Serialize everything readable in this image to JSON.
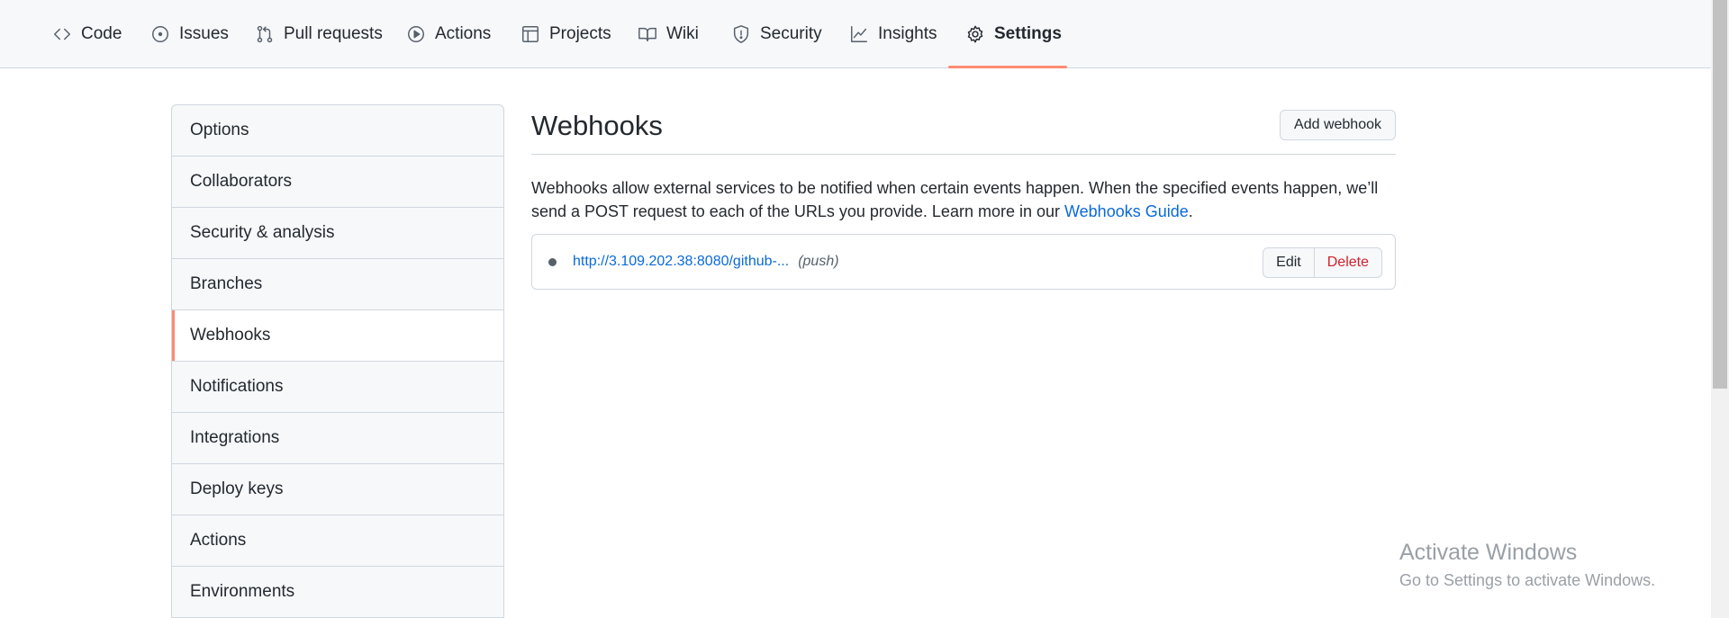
{
  "nav": {
    "tabs": [
      {
        "label": "Code",
        "icon": "code-icon"
      },
      {
        "label": "Issues",
        "icon": "issue-icon"
      },
      {
        "label": "Pull requests",
        "icon": "pull-request-icon"
      },
      {
        "label": "Actions",
        "icon": "play-icon"
      },
      {
        "label": "Projects",
        "icon": "table-icon"
      },
      {
        "label": "Wiki",
        "icon": "book-icon"
      },
      {
        "label": "Security",
        "icon": "shield-icon"
      },
      {
        "label": "Insights",
        "icon": "graph-icon"
      },
      {
        "label": "Settings",
        "icon": "gear-icon"
      }
    ],
    "active": "Settings"
  },
  "sidebar": {
    "items": [
      {
        "label": "Options"
      },
      {
        "label": "Collaborators"
      },
      {
        "label": "Security & analysis"
      },
      {
        "label": "Branches"
      },
      {
        "label": "Webhooks"
      },
      {
        "label": "Notifications"
      },
      {
        "label": "Integrations"
      },
      {
        "label": "Deploy keys"
      },
      {
        "label": "Actions"
      },
      {
        "label": "Environments"
      }
    ],
    "active": "Webhooks"
  },
  "main": {
    "title": "Webhooks",
    "add_button": "Add webhook",
    "description": "Webhooks allow external services to be notified when certain events happen. When the specified events happen, we’ll send a POST request to each of the URLs you provide. Learn more in our ",
    "guide_link": "Webhooks Guide",
    "description_end": ".",
    "webhooks": [
      {
        "url": "http://3.109.202.38:8080/github-...",
        "events": "(push)",
        "edit_label": "Edit",
        "delete_label": "Delete"
      }
    ]
  },
  "watermark": {
    "title": "Activate Windows",
    "subtitle": "Go to Settings to activate Windows."
  },
  "colors": {
    "accent_underline": "#fd8c73",
    "link": "#0969da",
    "danger": "#cf222e"
  }
}
